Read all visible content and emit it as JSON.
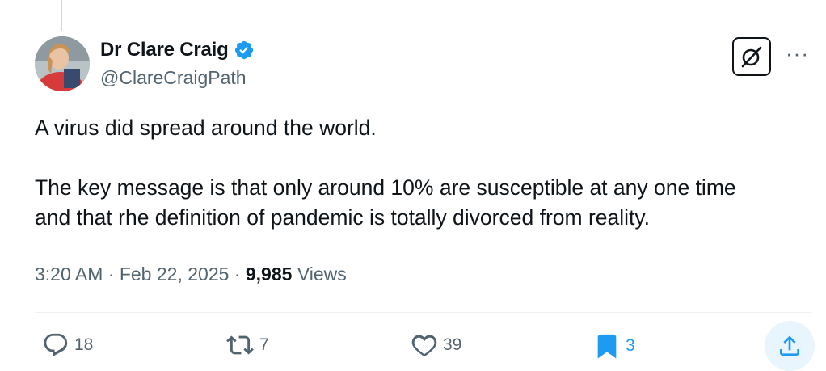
{
  "author": {
    "display_name": "Dr Clare Craig",
    "handle": "@ClareCraigPath",
    "verified": true,
    "verified_color": "#1d9bf0"
  },
  "tweet": {
    "paragraph_1": "A virus did spread around the world.",
    "paragraph_2_line_1": "The key message is that only around 10% are susceptible at any one time",
    "paragraph_2_line_2": "and that rhe definition of pandemic is totally divorced from reality."
  },
  "meta": {
    "time": "3:20 AM",
    "separator": "·",
    "date": "Feb 22, 2025",
    "views_count": "9,985",
    "views_label": "Views"
  },
  "actions": {
    "replies": "18",
    "reposts": "7",
    "likes": "39",
    "bookmarks": "3",
    "bookmarked": true
  },
  "icons": {
    "grok": "grok-icon",
    "more": "more-icon",
    "reply": "reply-icon",
    "repost": "repost-icon",
    "like": "heart-icon",
    "bookmark": "bookmark-icon",
    "share": "share-icon"
  },
  "colors": {
    "text": "#0f1419",
    "secondary": "#536471",
    "accent": "#1d9bf0"
  }
}
